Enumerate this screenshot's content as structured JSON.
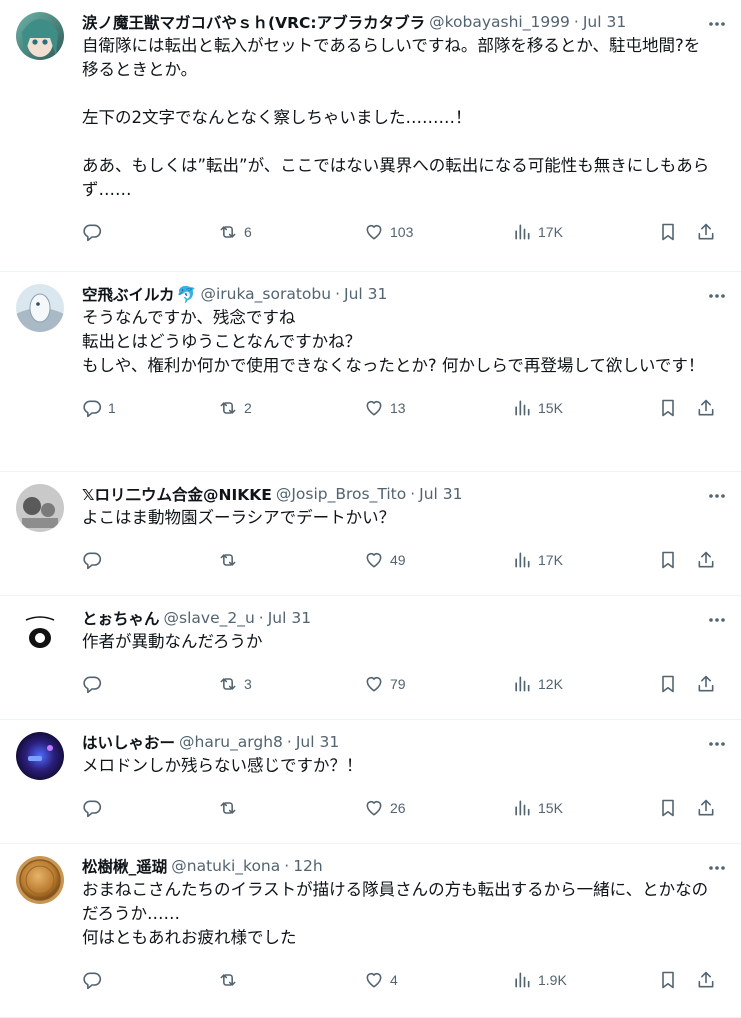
{
  "tweets": [
    {
      "name": "涙ノ魔王獣マガコバやｓｈ(VRC:アブラカタブラ",
      "emoji": "",
      "handle": "@kobayashi_1999",
      "time": "Jul 31",
      "text": "自衛隊には転出と転入がセットであるらしいですね。部隊を移るとか、駐屯地間?を移るときとか。\n\n左下の2文字でなんとなく察しちゃいました………！\n\nああ、もしくは”転出”が、ここではない異界への転出になる可能性も無きにしもあらず……",
      "replies": "",
      "retweets": "6",
      "likes": "103",
      "views": "17K",
      "avatar": "anime-girl-avatar"
    },
    {
      "name": "空飛ぶイルカ",
      "emoji": "🐬",
      "handle": "@iruka_soratobu",
      "time": "Jul 31",
      "text": "そうなんですか、残念ですね\n転出とはどうゆうことなんですかね？\nもしや、権利か何かで使用できなくなったとか? 何かしらで再登場して欲しいです！",
      "replies": "1",
      "retweets": "2",
      "likes": "13",
      "views": "15K",
      "avatar": "dolphin-avatar"
    },
    {
      "name": "𝕏ロリ二ウム合金@NIKKE",
      "emoji": "",
      "handle": "@Josip_Bros_Tito",
      "time": "Jul 31",
      "text": "よこはま動物園ズーラシアでデートかい？",
      "replies": "",
      "retweets": "",
      "likes": "49",
      "views": "17K",
      "avatar": "photo-avatar"
    },
    {
      "name": "とぉちゃん",
      "emoji": "",
      "handle": "@slave_2_u",
      "time": "Jul 31",
      "text": "作者が異動なんだろうか",
      "replies": "",
      "retweets": "3",
      "likes": "79",
      "views": "12K",
      "avatar": "drawing-avatar"
    },
    {
      "name": "はいしゃおー",
      "emoji": "",
      "handle": "@haru_argh8",
      "time": "Jul 31",
      "text": "メロドンしか残らない感じですか？！",
      "replies": "",
      "retweets": "",
      "likes": "26",
      "views": "15K",
      "avatar": "neon-avatar"
    },
    {
      "name": "松樹楸_遥瑚",
      "emoji": "",
      "handle": "@natuki_kona",
      "time": "12h",
      "text": "おまねこさんたちのイラストが描ける隊員さんの方も転出するから一緒に、とかなのだろうか……\n何はともあれお疲れ様でした",
      "replies": "",
      "retweets": "",
      "likes": "4",
      "views": "1.9K",
      "avatar": "coin-avatar"
    }
  ],
  "colors": {
    "text": "#0f1419",
    "muted": "#536471",
    "border": "#eff3f4"
  }
}
